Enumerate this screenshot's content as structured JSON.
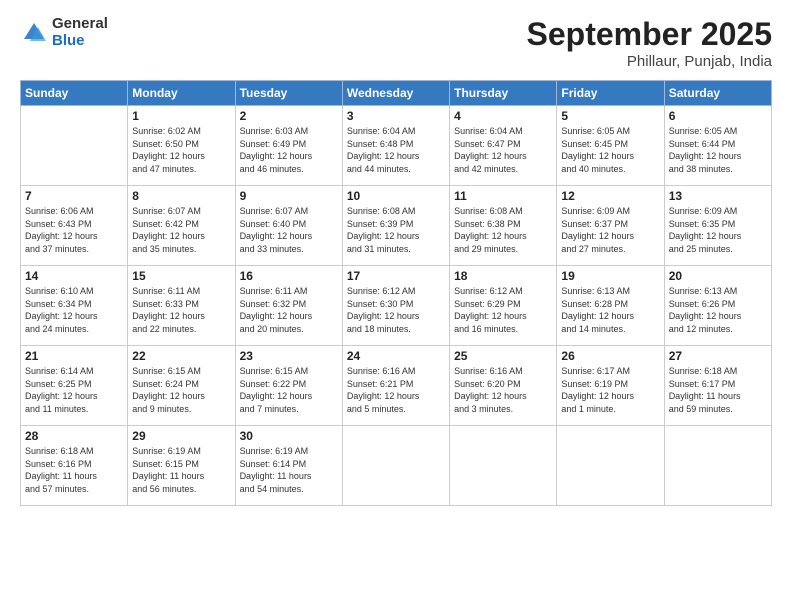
{
  "header": {
    "logo_general": "General",
    "logo_blue": "Blue",
    "title": "September 2025",
    "location": "Phillaur, Punjab, India"
  },
  "days_of_week": [
    "Sunday",
    "Monday",
    "Tuesday",
    "Wednesday",
    "Thursday",
    "Friday",
    "Saturday"
  ],
  "weeks": [
    [
      {
        "day": "",
        "info": ""
      },
      {
        "day": "1",
        "info": "Sunrise: 6:02 AM\nSunset: 6:50 PM\nDaylight: 12 hours\nand 47 minutes."
      },
      {
        "day": "2",
        "info": "Sunrise: 6:03 AM\nSunset: 6:49 PM\nDaylight: 12 hours\nand 46 minutes."
      },
      {
        "day": "3",
        "info": "Sunrise: 6:04 AM\nSunset: 6:48 PM\nDaylight: 12 hours\nand 44 minutes."
      },
      {
        "day": "4",
        "info": "Sunrise: 6:04 AM\nSunset: 6:47 PM\nDaylight: 12 hours\nand 42 minutes."
      },
      {
        "day": "5",
        "info": "Sunrise: 6:05 AM\nSunset: 6:45 PM\nDaylight: 12 hours\nand 40 minutes."
      },
      {
        "day": "6",
        "info": "Sunrise: 6:05 AM\nSunset: 6:44 PM\nDaylight: 12 hours\nand 38 minutes."
      }
    ],
    [
      {
        "day": "7",
        "info": "Sunrise: 6:06 AM\nSunset: 6:43 PM\nDaylight: 12 hours\nand 37 minutes."
      },
      {
        "day": "8",
        "info": "Sunrise: 6:07 AM\nSunset: 6:42 PM\nDaylight: 12 hours\nand 35 minutes."
      },
      {
        "day": "9",
        "info": "Sunrise: 6:07 AM\nSunset: 6:40 PM\nDaylight: 12 hours\nand 33 minutes."
      },
      {
        "day": "10",
        "info": "Sunrise: 6:08 AM\nSunset: 6:39 PM\nDaylight: 12 hours\nand 31 minutes."
      },
      {
        "day": "11",
        "info": "Sunrise: 6:08 AM\nSunset: 6:38 PM\nDaylight: 12 hours\nand 29 minutes."
      },
      {
        "day": "12",
        "info": "Sunrise: 6:09 AM\nSunset: 6:37 PM\nDaylight: 12 hours\nand 27 minutes."
      },
      {
        "day": "13",
        "info": "Sunrise: 6:09 AM\nSunset: 6:35 PM\nDaylight: 12 hours\nand 25 minutes."
      }
    ],
    [
      {
        "day": "14",
        "info": "Sunrise: 6:10 AM\nSunset: 6:34 PM\nDaylight: 12 hours\nand 24 minutes."
      },
      {
        "day": "15",
        "info": "Sunrise: 6:11 AM\nSunset: 6:33 PM\nDaylight: 12 hours\nand 22 minutes."
      },
      {
        "day": "16",
        "info": "Sunrise: 6:11 AM\nSunset: 6:32 PM\nDaylight: 12 hours\nand 20 minutes."
      },
      {
        "day": "17",
        "info": "Sunrise: 6:12 AM\nSunset: 6:30 PM\nDaylight: 12 hours\nand 18 minutes."
      },
      {
        "day": "18",
        "info": "Sunrise: 6:12 AM\nSunset: 6:29 PM\nDaylight: 12 hours\nand 16 minutes."
      },
      {
        "day": "19",
        "info": "Sunrise: 6:13 AM\nSunset: 6:28 PM\nDaylight: 12 hours\nand 14 minutes."
      },
      {
        "day": "20",
        "info": "Sunrise: 6:13 AM\nSunset: 6:26 PM\nDaylight: 12 hours\nand 12 minutes."
      }
    ],
    [
      {
        "day": "21",
        "info": "Sunrise: 6:14 AM\nSunset: 6:25 PM\nDaylight: 12 hours\nand 11 minutes."
      },
      {
        "day": "22",
        "info": "Sunrise: 6:15 AM\nSunset: 6:24 PM\nDaylight: 12 hours\nand 9 minutes."
      },
      {
        "day": "23",
        "info": "Sunrise: 6:15 AM\nSunset: 6:22 PM\nDaylight: 12 hours\nand 7 minutes."
      },
      {
        "day": "24",
        "info": "Sunrise: 6:16 AM\nSunset: 6:21 PM\nDaylight: 12 hours\nand 5 minutes."
      },
      {
        "day": "25",
        "info": "Sunrise: 6:16 AM\nSunset: 6:20 PM\nDaylight: 12 hours\nand 3 minutes."
      },
      {
        "day": "26",
        "info": "Sunrise: 6:17 AM\nSunset: 6:19 PM\nDaylight: 12 hours\nand 1 minute."
      },
      {
        "day": "27",
        "info": "Sunrise: 6:18 AM\nSunset: 6:17 PM\nDaylight: 11 hours\nand 59 minutes."
      }
    ],
    [
      {
        "day": "28",
        "info": "Sunrise: 6:18 AM\nSunset: 6:16 PM\nDaylight: 11 hours\nand 57 minutes."
      },
      {
        "day": "29",
        "info": "Sunrise: 6:19 AM\nSunset: 6:15 PM\nDaylight: 11 hours\nand 56 minutes."
      },
      {
        "day": "30",
        "info": "Sunrise: 6:19 AM\nSunset: 6:14 PM\nDaylight: 11 hours\nand 54 minutes."
      },
      {
        "day": "",
        "info": ""
      },
      {
        "day": "",
        "info": ""
      },
      {
        "day": "",
        "info": ""
      },
      {
        "day": "",
        "info": ""
      }
    ]
  ]
}
